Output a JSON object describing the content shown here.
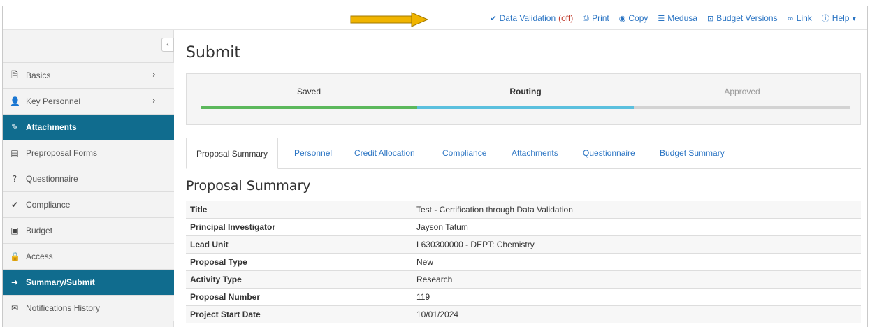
{
  "toolbar": {
    "data_validation": "Data Validation",
    "data_validation_state": "(off)",
    "print": "Print",
    "copy": "Copy",
    "medusa": "Medusa",
    "budget_versions": "Budget Versions",
    "link": "Link",
    "help": "Help",
    "arrow_color": "#f0b400"
  },
  "sidebar": {
    "items": [
      {
        "label": "Basics",
        "icon": "document-icon",
        "expandable": true,
        "active": false
      },
      {
        "label": "Key Personnel",
        "icon": "person-icon",
        "expandable": true,
        "active": false
      },
      {
        "label": "Attachments",
        "icon": "paperclip-icon",
        "expandable": false,
        "active": true
      },
      {
        "label": "Preproposal Forms",
        "icon": "file-icon",
        "expandable": false,
        "active": false
      },
      {
        "label": "Questionnaire",
        "icon": "question-circle-icon",
        "expandable": false,
        "active": false
      },
      {
        "label": "Compliance",
        "icon": "check-icon",
        "expandable": false,
        "active": false
      },
      {
        "label": "Budget",
        "icon": "money-icon",
        "expandable": false,
        "active": false
      },
      {
        "label": "Access",
        "icon": "lock-icon",
        "expandable": false,
        "active": false
      },
      {
        "label": "Summary/Submit",
        "icon": "sign-out-icon",
        "expandable": false,
        "active": true
      },
      {
        "label": "Notifications History",
        "icon": "envelope-icon",
        "expandable": false,
        "active": false
      }
    ],
    "active_color": "#106c8e"
  },
  "main": {
    "title": "Submit",
    "status": {
      "steps": [
        {
          "label": "Saved",
          "color": "#5cb85c"
        },
        {
          "label": "Routing",
          "color": "#5bc0de"
        },
        {
          "label": "Approved",
          "color": "#d3d3d3"
        }
      ]
    },
    "tabs": [
      "Proposal Summary",
      "Personnel",
      "Credit Allocation",
      "Compliance",
      "Attachments",
      "Questionnaire",
      "Budget Summary"
    ],
    "section_title": "Proposal Summary",
    "summary": [
      {
        "label": "Title",
        "value": "Test - Certification through Data Validation"
      },
      {
        "label": "Principal Investigator",
        "value": "Jayson Tatum"
      },
      {
        "label": "Lead Unit",
        "value": "L630300000 - DEPT: Chemistry"
      },
      {
        "label": "Proposal Type",
        "value": "New"
      },
      {
        "label": "Activity Type",
        "value": "Research"
      },
      {
        "label": "Proposal Number",
        "value": "119"
      },
      {
        "label": "Project Start Date",
        "value": "10/01/2024"
      }
    ]
  }
}
